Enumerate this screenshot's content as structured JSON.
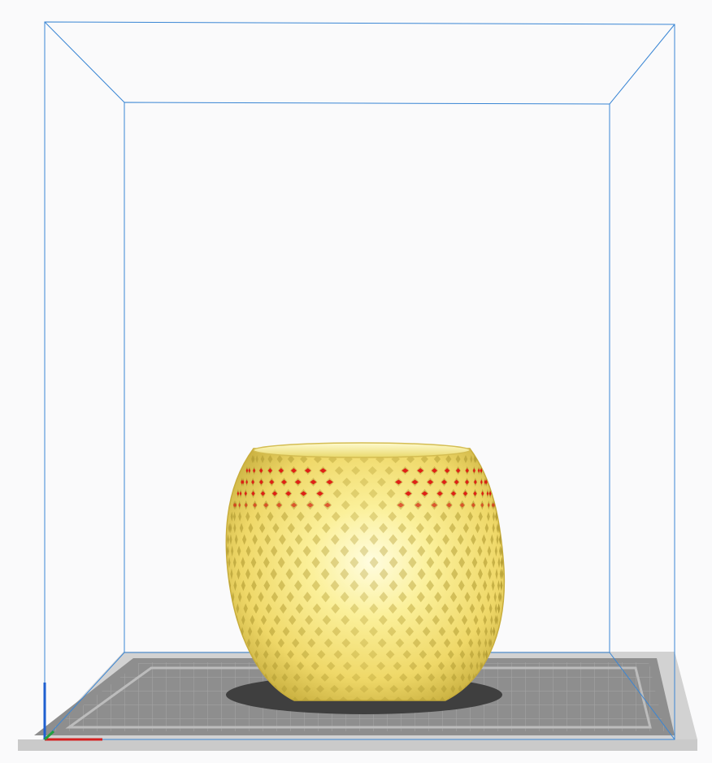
{
  "viewport": {
    "background": "#fafafb",
    "build_volume_color": "#3a86d4",
    "model_color": "#f6e77c",
    "overhang_color": "#e01010",
    "bed_plate_color": "#9a9a9a",
    "bed_border_color": "#c8c8c8"
  },
  "axes": {
    "x_color": "#d42020",
    "y_color": "#20a040",
    "z_color": "#1e5fd0"
  },
  "model": {
    "name_icon": "lattice-vase-model"
  }
}
